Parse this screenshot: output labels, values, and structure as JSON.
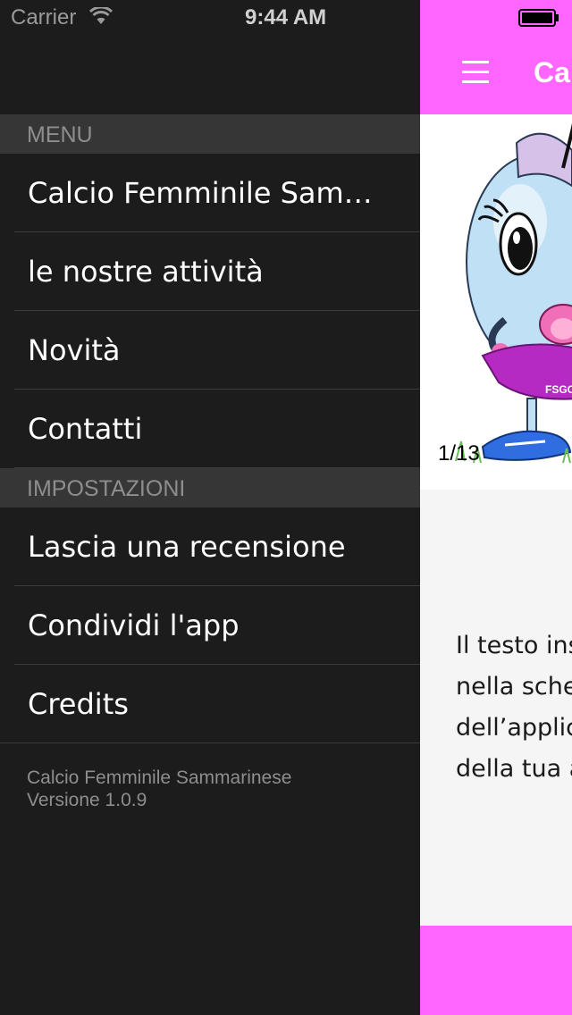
{
  "status_bar": {
    "carrier": "Carrier",
    "time": "9:44 AM",
    "icons": [
      "wifi-icon",
      "battery-icon"
    ]
  },
  "menu": {
    "section_menu": "MENU",
    "items": [
      {
        "label": "Calcio Femminile Sam…"
      },
      {
        "label": "le nostre attività"
      },
      {
        "label": "Novità"
      },
      {
        "label": "Contatti"
      }
    ],
    "section_settings": "IMPOSTAZIONI",
    "settings_items": [
      {
        "label": "Lascia una recensione"
      },
      {
        "label": "Condividi l'app"
      },
      {
        "label": "Credits"
      }
    ],
    "footer": {
      "app_name": "Calcio Femminile Sammarinese",
      "version": "Versione 1.0.9"
    }
  },
  "content": {
    "nav_title": "Ca",
    "gallery_counter": "1/13",
    "mascot_text": "FSGC",
    "body_lines": [
      "Il testo ins",
      "nella sche",
      "dell’applic",
      "della tua a"
    ]
  },
  "colors": {
    "accent": "#ff66ff",
    "menu_background": "#1c1c1c",
    "section_header": "#363636"
  }
}
